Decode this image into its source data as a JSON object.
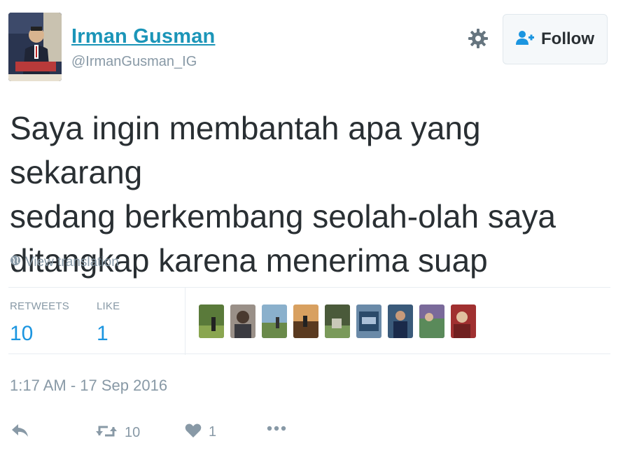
{
  "user": {
    "name": "Irman Gusman",
    "handle": "@IrmanGusman_IG"
  },
  "follow_button": {
    "label": "Follow"
  },
  "tweet": {
    "lines": [
      "Saya ingin membantah apa yang sekarang",
      "sedang berkembang seolah-olah saya",
      "ditangkap karena menerima suap"
    ]
  },
  "translation": {
    "label": "View translation"
  },
  "stats": {
    "retweets_label": "RETWEETS",
    "retweets_value": "10",
    "likes_label": "LIKE",
    "likes_value": "1"
  },
  "timestamp": "1:17 AM - 17 Sep 2016",
  "actions": {
    "retweet_count": "10",
    "like_count": "1"
  },
  "colors": {
    "name_link": "#1b95b8",
    "stat_value": "#1b95e0",
    "muted": "#8899a6",
    "text": "#292f33"
  }
}
